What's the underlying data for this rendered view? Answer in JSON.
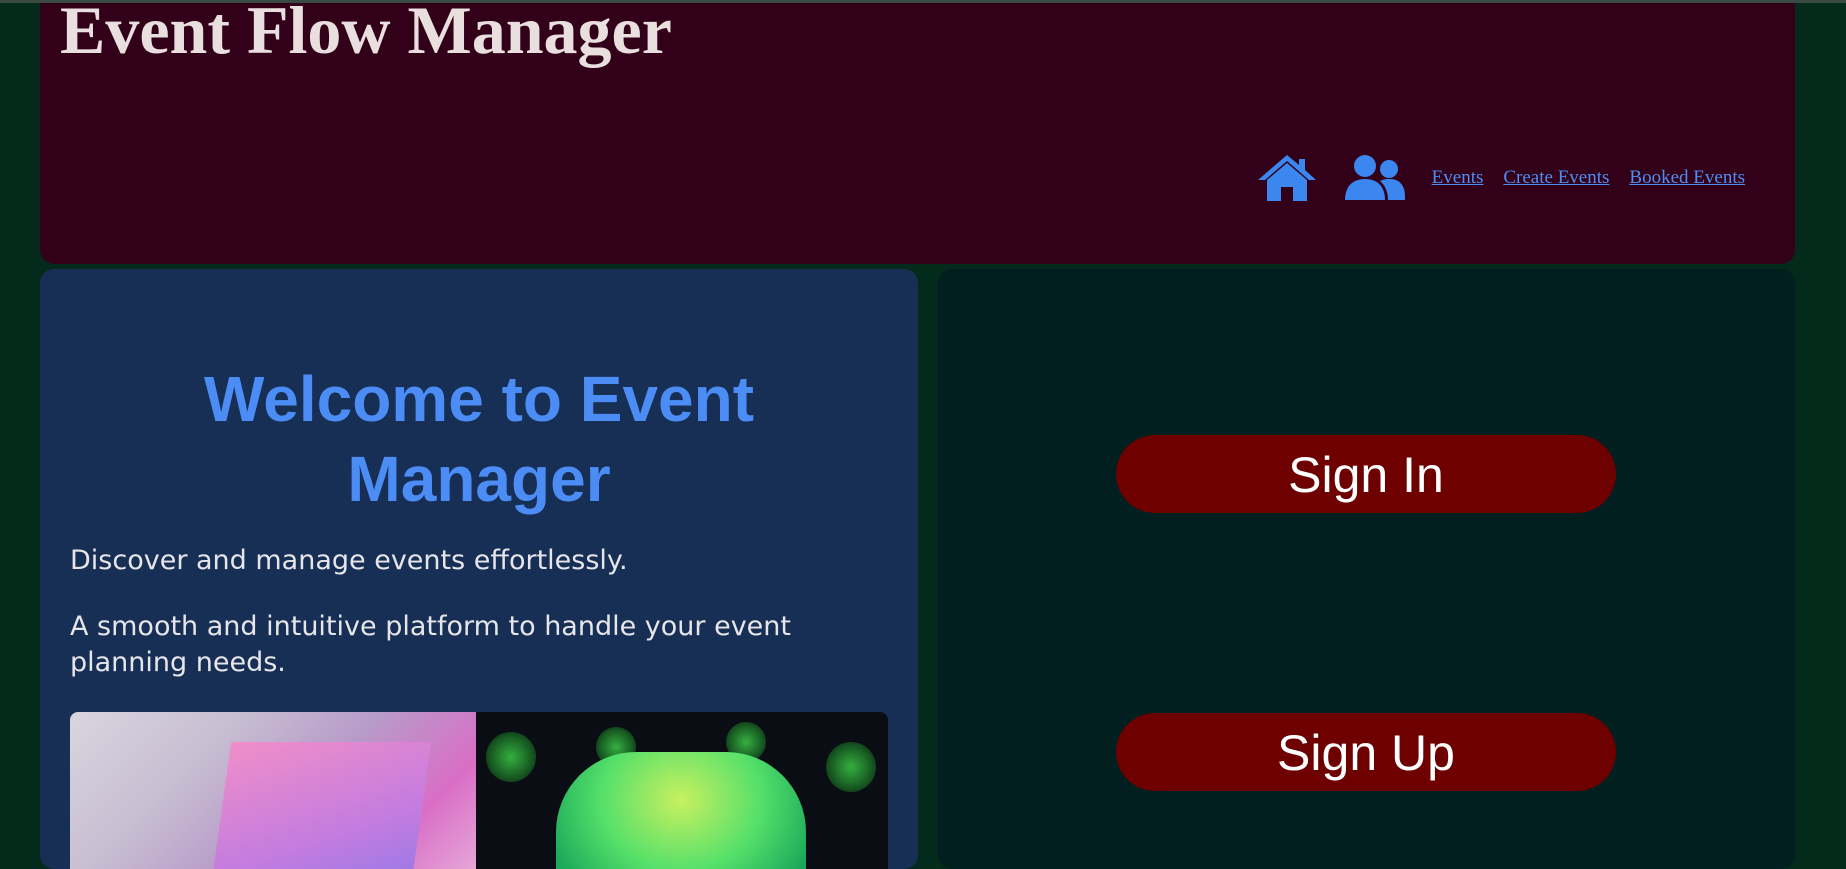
{
  "header": {
    "title": "Event Flow Manager",
    "nav": {
      "home_icon": "home-icon",
      "users_icon": "users-icon",
      "links": [
        "Events",
        "Create Events",
        "Booked Events"
      ]
    }
  },
  "main": {
    "welcome_line1": "Welcome to Event",
    "welcome_line2": "Manager",
    "description1": "Discover and manage events effortlessly.",
    "description2": "A smooth and intuitive platform to handle your event planning needs."
  },
  "auth": {
    "sign_in_label": "Sign In",
    "sign_up_label": "Sign Up"
  },
  "colors": {
    "background": "#042a1c",
    "header_bg": "#33001a",
    "left_panel_bg": "#172e55",
    "right_panel_bg": "#011f1f",
    "accent_blue": "#4c8df5",
    "button_red": "#6e0000"
  }
}
